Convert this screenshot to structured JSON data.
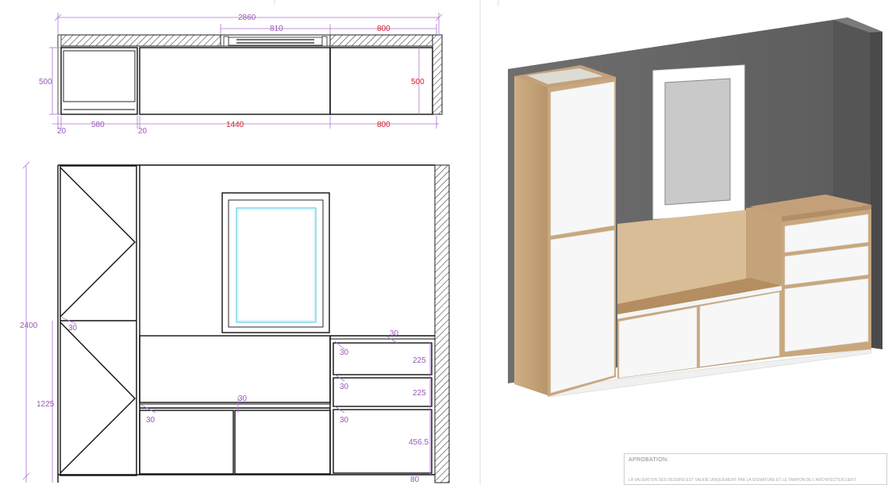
{
  "plan_dimensions": {
    "overall_width": "2860",
    "window_width": "810",
    "right_width_top": "800",
    "depth_left": "500",
    "depth_right": "500",
    "side_left": "20",
    "column_width": "580",
    "side_right": "20",
    "center_width": "1440",
    "right_width_bottom": "800"
  },
  "elevation_dimensions": {
    "total_height": "2400",
    "base_height": "1225",
    "gap_column": "30",
    "gap_center_top": "30",
    "gap_center_left": "30",
    "gap_right_top": "30",
    "gap_drawer_1": "30",
    "gap_drawer_2": "30",
    "gap_drawer_3": "30",
    "drawer_1": "225",
    "drawer_2": "225",
    "drawer_3": "456.5",
    "plinth": "80"
  },
  "approval": {
    "title": "APROBATION:",
    "body": "LA VALIDATION DES DESSINS EST VALIDE UNIQUEMENT PAR LA SIGNATURE ET LE TAMPON DE L'ARCHITECTE/CLIENT"
  },
  "colors": {
    "dimension": "#9b59b6",
    "highlight": "#d0202a",
    "wall": "#6a6a6a",
    "wood": "#c9a77d",
    "white_panel": "#f4f4f4"
  }
}
